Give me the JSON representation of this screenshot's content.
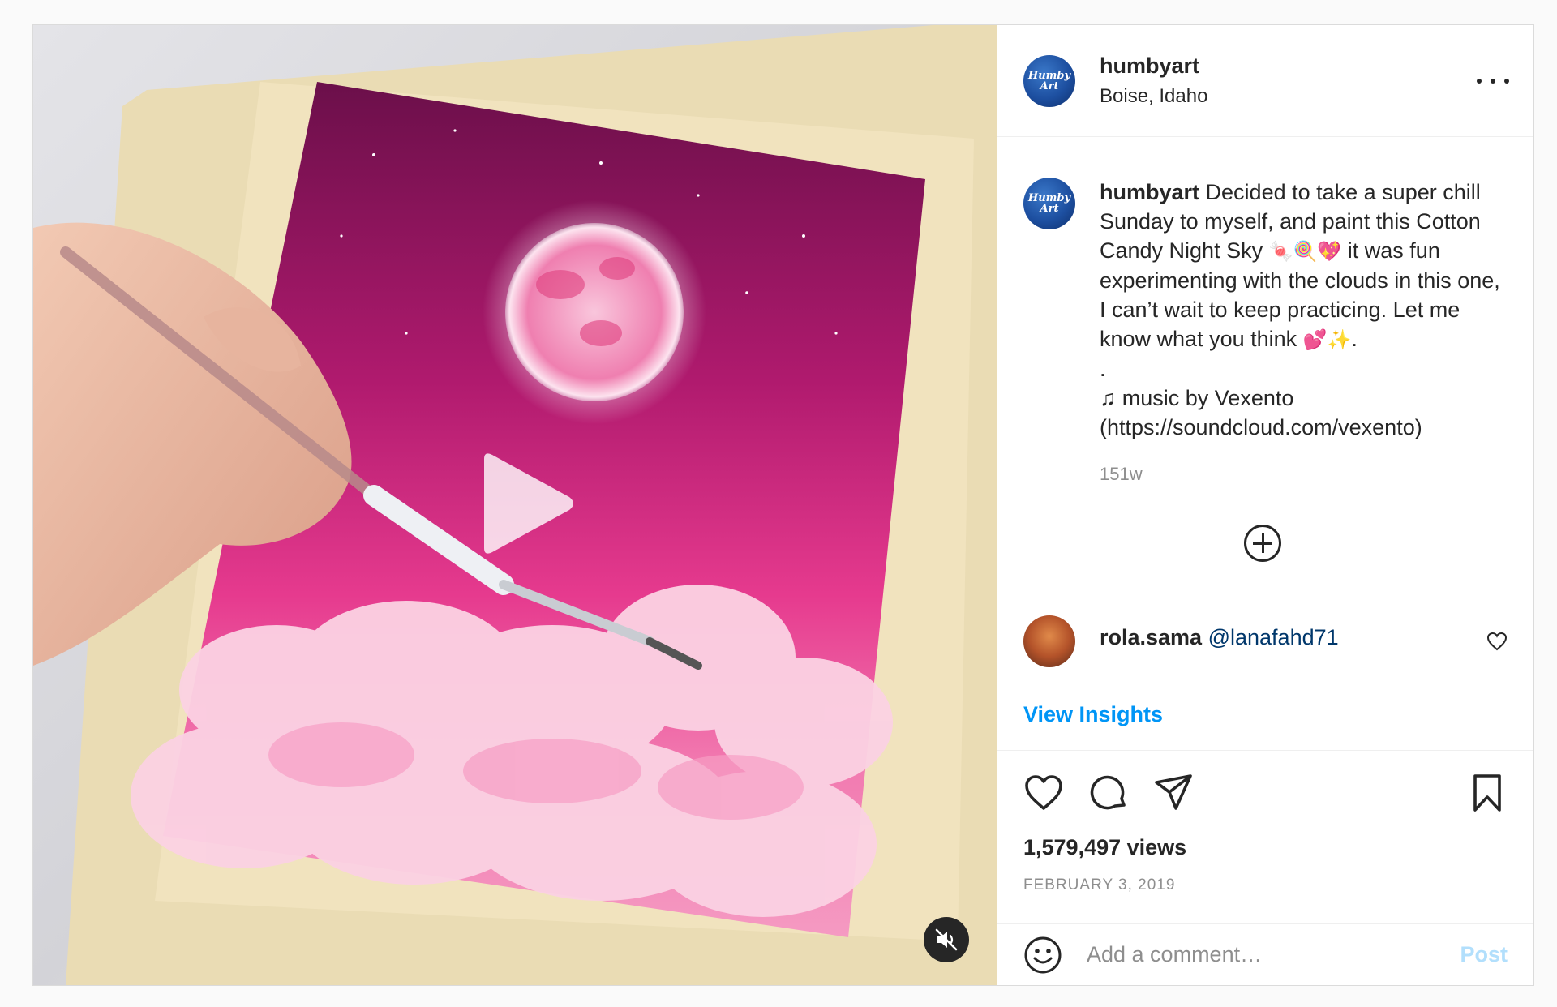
{
  "post": {
    "author": {
      "username": "humbyart",
      "location": "Boise, Idaho",
      "avatar_text": "Humby Art"
    },
    "more_options_icon": "ellipsis-icon",
    "caption": {
      "username": "humbyart",
      "text_1": "Decided to take a super chill Sunday to myself, and paint this Cotton Candy Night Sky",
      "emoji_1": "🍬🍭💖",
      "text_2": "it was fun experimenting with the clouds in this one, I can’t wait to keep practicing. Let me know what you think",
      "emoji_2": "💕✨",
      "text_3": ".",
      "dot_line": ".",
      "music_note": "♫",
      "music_line_1": "music by Vexento",
      "music_line_2": "(https://soundcloud.com/vexento)",
      "time": "151w"
    },
    "load_more_icon": "plus-circle-icon",
    "comment": {
      "username": "rola.sama",
      "mention": "@lanafahd71"
    },
    "insights_link": "View Insights",
    "views": "1,579,497 views",
    "date": "FEBRUARY 3, 2019",
    "add_comment": {
      "placeholder": "Add a comment…",
      "post_label": "Post"
    },
    "colors": {
      "link_blue": "#0095f6",
      "post_disabled": "#b2dffc",
      "mention": "#00376b",
      "muted": "#8e8e8e"
    }
  }
}
